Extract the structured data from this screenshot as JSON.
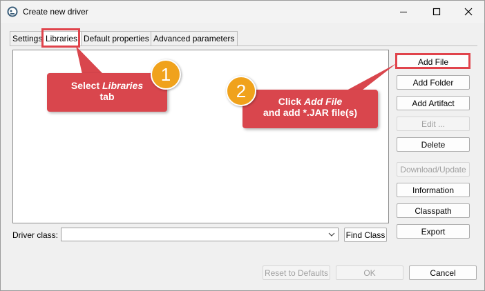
{
  "window": {
    "title": "Create new driver"
  },
  "tabs": [
    "Settings",
    "Libraries",
    "Default properties",
    "Advanced parameters"
  ],
  "side_buttons": {
    "add_file": "Add File",
    "add_folder": "Add Folder",
    "add_artifact": "Add Artifact",
    "edit": "Edit ...",
    "delete": "Delete",
    "download_update": "Download/Update",
    "information": "Information",
    "classpath": "Classpath",
    "export": "Export"
  },
  "driver_class": {
    "label": "Driver class:",
    "value": "",
    "find_class": "Find Class"
  },
  "footer": {
    "reset": "Reset to Defaults",
    "ok": "OK",
    "cancel": "Cancel"
  },
  "annotations": {
    "step1_number": "1",
    "step1_line1": "Select ",
    "step1_em": "Libraries",
    "step1_line2": "tab",
    "step2_number": "2",
    "step2_line1": "Click ",
    "step2_em": "Add File",
    "step2_line2": "and add *.JAR file(s)",
    "color": "#d9464d",
    "badge_color": "#f0a21c"
  }
}
